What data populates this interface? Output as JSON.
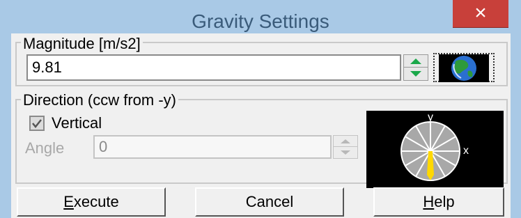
{
  "window": {
    "title": "Gravity Settings",
    "close_glyph": "×"
  },
  "magnitude": {
    "legend": "Magnitude [m/s2]",
    "value": "9.81",
    "earth_button_icon": "earth-globe-icon"
  },
  "direction": {
    "legend": "Direction (ccw from -y)",
    "vertical_label": "Vertical",
    "vertical_checked": true,
    "angle_label": "Angle",
    "angle_value": "0",
    "dial": {
      "y_label": "y",
      "x_label": "x",
      "angle_deg": 0,
      "pointer_color": "#ffd800"
    }
  },
  "buttons": {
    "execute_prefix": "",
    "execute_mnemonic": "E",
    "execute_rest": "xecute",
    "cancel": "Cancel",
    "help_mnemonic": "H",
    "help_rest": "elp"
  },
  "colors": {
    "spinner_accent": "#1aa84a",
    "dial_background": "#000000",
    "dial_face": "#a8a8a8"
  }
}
